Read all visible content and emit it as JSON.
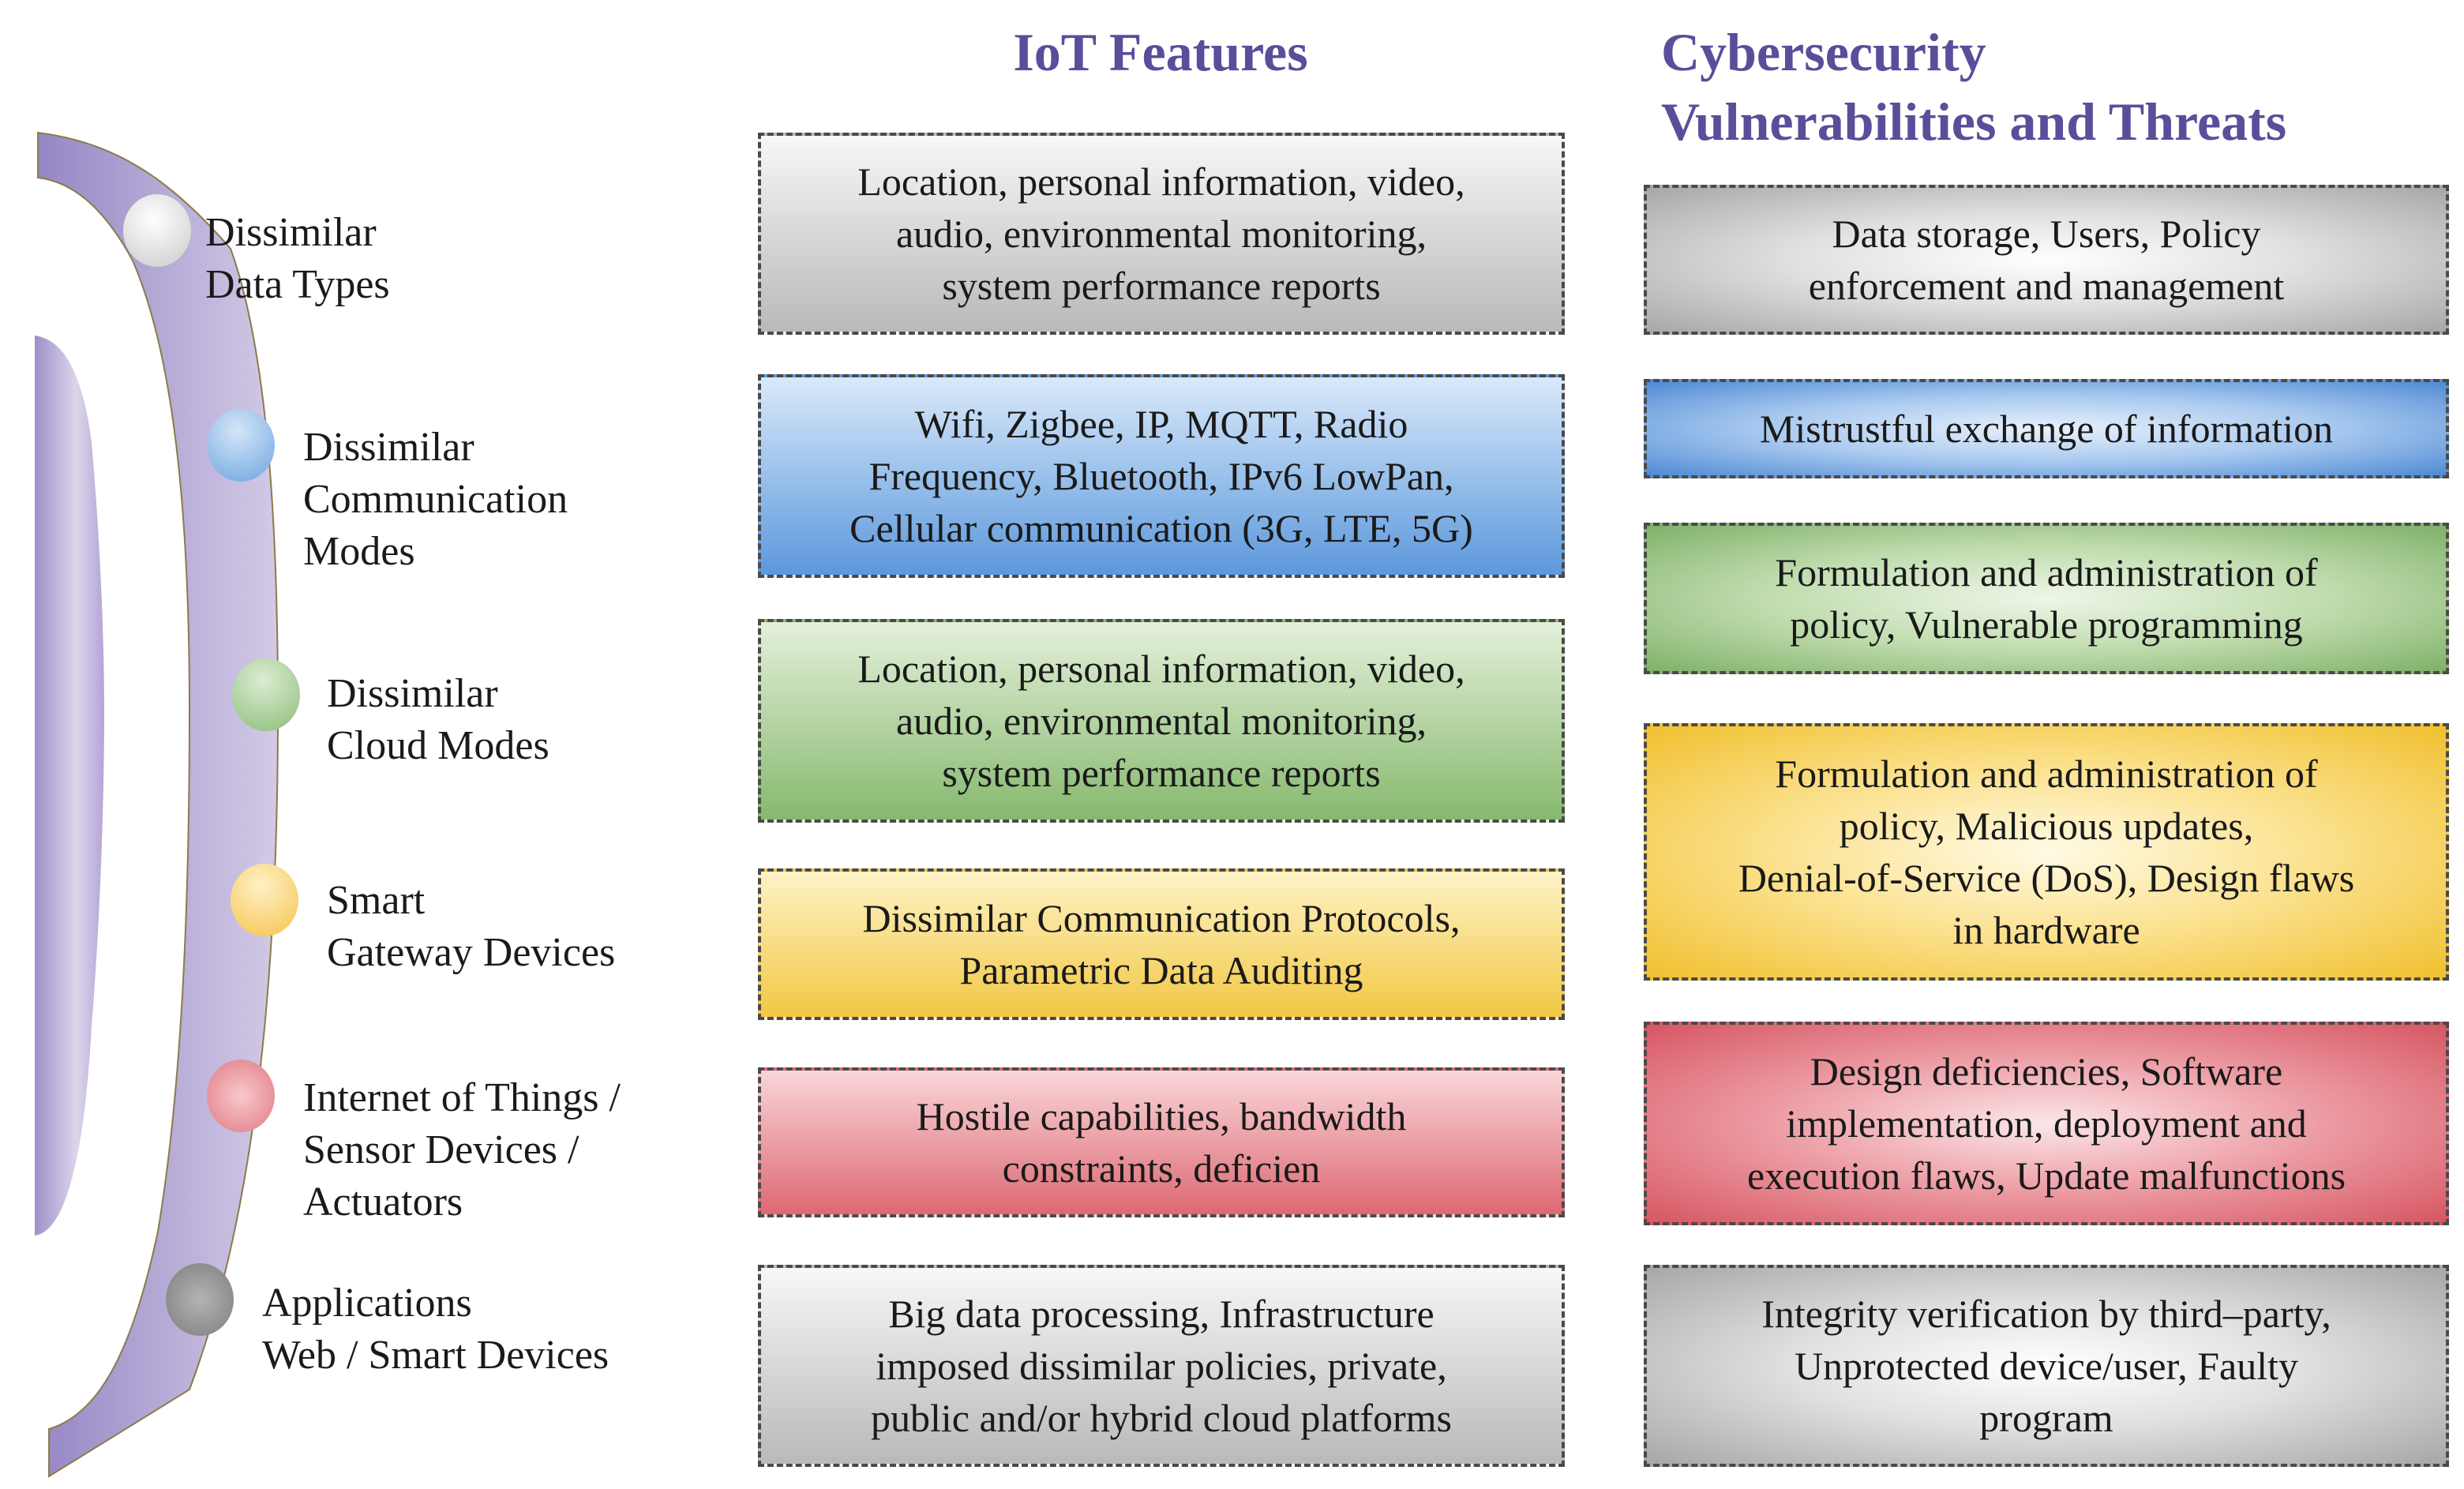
{
  "headings": {
    "iot_features": "IoT Features",
    "cyber_line1": "Cybersecurity",
    "cyber_line2": "Vulnerabilities and Threats"
  },
  "layers": [
    {
      "label_lines": [
        "Dissimilar",
        "Data Types"
      ],
      "color": "gray-white",
      "dot_color": "#d8d8d8"
    },
    {
      "label_lines": [
        "Dissimilar",
        "Communication",
        "Modes"
      ],
      "color": "blue",
      "dot_color": "#7eb0e6"
    },
    {
      "label_lines": [
        "Dissimilar",
        "Cloud Modes"
      ],
      "color": "green",
      "dot_color": "#9cc98a"
    },
    {
      "label_lines": [
        "Smart",
        "Gateway Devices"
      ],
      "color": "yellow",
      "dot_color": "#f8d26a"
    },
    {
      "label_lines": [
        "Internet of Things /",
        "Sensor Devices /",
        "Actuators"
      ],
      "color": "red",
      "dot_color": "#ea8a92"
    },
    {
      "label_lines": [
        "Applications",
        "Web / Smart Devices"
      ],
      "color": "gray",
      "dot_color": "#8e8e8e"
    }
  ],
  "iot_features": [
    {
      "lines": [
        "Location, personal information, video,",
        "audio, environmental monitoring,",
        "system performance reports"
      ],
      "color": "gray"
    },
    {
      "lines": [
        "Wifi, Zigbee, IP, MQTT, Radio",
        "Frequency, Bluetooth, IPv6 LowPan,",
        "Cellular communication (3G, LTE, 5G)"
      ],
      "color": "blue"
    },
    {
      "lines": [
        "Location, personal information, video,",
        "audio, environmental monitoring,",
        "system performance reports"
      ],
      "color": "green"
    },
    {
      "lines": [
        "Dissimilar Communication Protocols,",
        "Parametric Data Auditing"
      ],
      "color": "yellow"
    },
    {
      "lines": [
        "Hostile capabilities, bandwidth",
        "constraints, deficien"
      ],
      "color": "red"
    },
    {
      "lines": [
        "Big data processing, Infrastructure",
        "imposed dissimilar policies, private,",
        "public and/or hybrid cloud platforms"
      ],
      "color": "gray"
    }
  ],
  "threats": [
    {
      "lines": [
        "Data storage, Users, Policy",
        "enforcement and management"
      ],
      "color": "gray"
    },
    {
      "lines": [
        "Mistrustful exchange of information"
      ],
      "color": "blue"
    },
    {
      "lines": [
        "Formulation and administration of",
        "policy, Vulnerable programming"
      ],
      "color": "green"
    },
    {
      "lines": [
        "Formulation and administration of",
        "policy, Malicious updates,",
        "Denial-of-Service (DoS), Design flaws",
        "in hardware"
      ],
      "color": "yellow"
    },
    {
      "lines": [
        "Design deficiencies, Software",
        "implementation, deployment and",
        "execution flaws, Update malfunctions"
      ],
      "color": "red"
    },
    {
      "lines": [
        "Integrity verification by third–party,",
        "Unprotected device/user, Faulty",
        "program"
      ],
      "color": "gray"
    }
  ]
}
